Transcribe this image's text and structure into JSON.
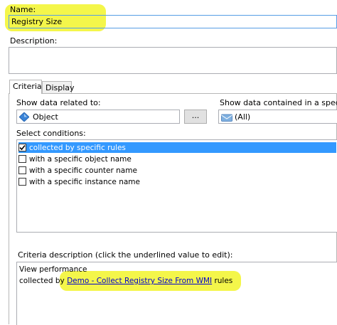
{
  "name": {
    "label": "Name:",
    "value": "Registry Size"
  },
  "description": {
    "label": "Description:",
    "value": ""
  },
  "tabs": [
    {
      "label": "Criteria",
      "active": true
    },
    {
      "label": "Display",
      "active": false
    }
  ],
  "show_related": {
    "label": "Show data related to:",
    "value": "Object",
    "browse_label": "..."
  },
  "show_contained": {
    "label": "Show data contained in a specifi",
    "value": "(All)"
  },
  "conditions": {
    "label": "Select conditions:",
    "items": [
      {
        "label": "collected by specific rules",
        "checked": true,
        "selected": true
      },
      {
        "label": "with a specific object name",
        "checked": false,
        "selected": false
      },
      {
        "label": "with a specific counter name",
        "checked": false,
        "selected": false
      },
      {
        "label": "with a specific instance name",
        "checked": false,
        "selected": false
      }
    ]
  },
  "criteria": {
    "label": "Criteria description (click the underlined value to edit):",
    "line1": "View performance",
    "line2_prefix": "collected by ",
    "line2_link": "Demo - Collect Registry Size From WMI",
    "line2_suffix": " rules"
  },
  "colors": {
    "highlight": "#f4f64a",
    "selection": "#3399ff",
    "link": "#0000cc"
  }
}
